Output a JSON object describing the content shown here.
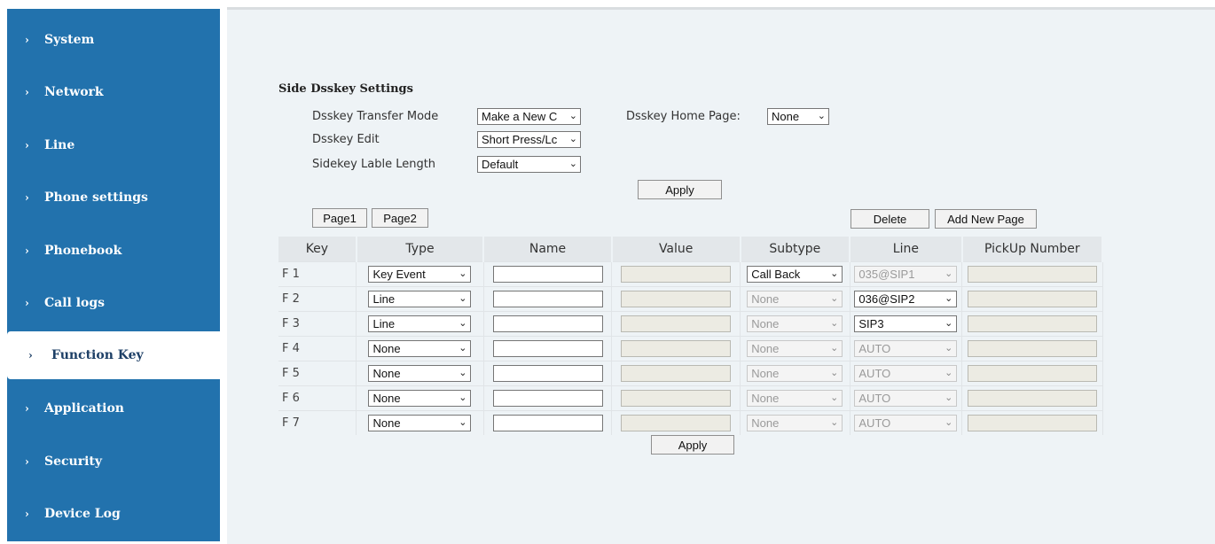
{
  "sidebar": {
    "items": [
      {
        "label": "System"
      },
      {
        "label": "Network"
      },
      {
        "label": "Line"
      },
      {
        "label": "Phone settings"
      },
      {
        "label": "Phonebook"
      },
      {
        "label": "Call logs"
      },
      {
        "label": "Function Key",
        "active": true
      },
      {
        "label": "Application"
      },
      {
        "label": "Security"
      },
      {
        "label": "Device Log"
      }
    ],
    "chevron": "›"
  },
  "main": {
    "section_title": "Side Dsskey Settings",
    "transfer_mode_label": "Dsskey Transfer Mode",
    "transfer_mode_value": "Make a New C",
    "home_page_label": "Dsskey Home Page:",
    "home_page_value": "None",
    "edit_label": "Dsskey Edit",
    "edit_value": "Short Press/Lc",
    "label_length_label": "Sidekey Lable Length",
    "label_length_value": "Default",
    "apply_top": "Apply",
    "page1": "Page1",
    "page2": "Page2",
    "delete": "Delete",
    "add_page": "Add New Page",
    "apply_bottom": "Apply",
    "arrow": "⌄"
  },
  "table": {
    "headers": [
      "Key",
      "Type",
      "Name",
      "Value",
      "Subtype",
      "Line",
      "PickUp Number"
    ],
    "rows": [
      {
        "key": "F 1",
        "type": "Key Event",
        "name": "",
        "value": "",
        "subtype": "Call Back",
        "subtype_enabled": true,
        "line": "035@SIP1",
        "line_enabled": false
      },
      {
        "key": "F 2",
        "type": "Line",
        "name": "",
        "value": "",
        "subtype": "None",
        "subtype_enabled": false,
        "line": "036@SIP2",
        "line_enabled": true
      },
      {
        "key": "F 3",
        "type": "Line",
        "name": "",
        "value": "",
        "subtype": "None",
        "subtype_enabled": false,
        "line": "SIP3",
        "line_enabled": true
      },
      {
        "key": "F 4",
        "type": "None",
        "name": "",
        "value": "",
        "subtype": "None",
        "subtype_enabled": false,
        "line": "AUTO",
        "line_enabled": false
      },
      {
        "key": "F 5",
        "type": "None",
        "name": "",
        "value": "",
        "subtype": "None",
        "subtype_enabled": false,
        "line": "AUTO",
        "line_enabled": false
      },
      {
        "key": "F 6",
        "type": "None",
        "name": "",
        "value": "",
        "subtype": "None",
        "subtype_enabled": false,
        "line": "AUTO",
        "line_enabled": false
      },
      {
        "key": "F 7",
        "type": "None",
        "name": "",
        "value": "",
        "subtype": "None",
        "subtype_enabled": false,
        "line": "AUTO",
        "line_enabled": false
      }
    ]
  },
  "colors": {
    "sidebar": "#2272ad",
    "main_bg": "#eef3f6",
    "active_text": "#1d3f66"
  }
}
